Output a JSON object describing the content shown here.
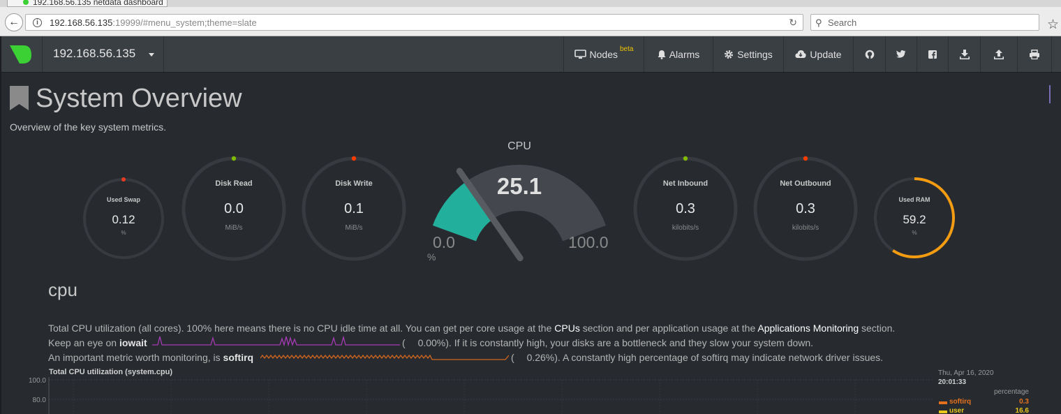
{
  "browser": {
    "tab_title": "192.168.56.135 netdata dashboard",
    "url_host": "192.168.56.135",
    "url_rest": ":19999/#menu_system;theme=slate",
    "search_placeholder": "Search"
  },
  "navbar": {
    "node_name": "192.168.56.135",
    "nodes_label": "Nodes",
    "nodes_badge": "beta",
    "alarms_label": "Alarms",
    "settings_label": "Settings",
    "update_label": "Update",
    "icons": [
      "github-icon",
      "twitter-icon",
      "facebook-icon",
      "download-icon",
      "upload-icon",
      "print-icon"
    ]
  },
  "page": {
    "title": "System Overview",
    "subtitle": "Overview of the key system metrics."
  },
  "gauges": {
    "swap": {
      "title": "Used Swap",
      "value": "0.12",
      "unit": "%",
      "fraction": 0.0012,
      "color": "#e63b22"
    },
    "disk_read": {
      "title": "Disk Read",
      "value": "0.0",
      "unit": "MiB/s",
      "fraction": 0,
      "color": "#7fba00"
    },
    "disk_write": {
      "title": "Disk Write",
      "value": "0.1",
      "unit": "MiB/s",
      "fraction": 0.005,
      "color": "#ff3c00"
    },
    "cpu": {
      "title": "CPU",
      "value": "25.1",
      "min": "0.0",
      "max": "100.0",
      "unit": "%",
      "fraction": 0.251,
      "color": "#22b09c"
    },
    "net_in": {
      "title": "Net Inbound",
      "value": "0.3",
      "unit": "kilobits/s",
      "fraction": 0,
      "color": "#7fba00"
    },
    "net_out": {
      "title": "Net Outbound",
      "value": "0.3",
      "unit": "kilobits/s",
      "fraction": 0.005,
      "color": "#ff3c00"
    },
    "ram": {
      "title": "Used RAM",
      "value": "59.2",
      "unit": "%",
      "fraction": 0.592,
      "color": "#f39c12"
    }
  },
  "cpu_section": {
    "title": "cpu",
    "line1_a": "Total CPU utilization (all cores). 100% here means there is no CPU idle time at all. You can get per core usage at the",
    "line1_link1": "CPUs",
    "line1_b": "section and per application usage at the",
    "line1_link2": "Applications Monitoring",
    "line1_c": "section.",
    "line2_a": "Keep an eye on",
    "line2_metric": "iowait",
    "line2_open": "(",
    "line2_value": "0.00%).",
    "line2_b": "If it is constantly high, your disks are a bottleneck and they slow your system down.",
    "line3_a": "An important metric worth monitoring, is",
    "line3_metric": "softirq",
    "line3_open": "(",
    "line3_value": "0.26%).",
    "line3_b": "A constantly high percentage of softirq may indicate network driver issues."
  },
  "chart": {
    "title": "Total CPU utilization (system.cpu)",
    "y_ticks": [
      "100.0",
      "80.0"
    ],
    "legend_date": "Thu, Apr 16, 2020",
    "legend_time": "20:01:33",
    "legend_units": "percentage",
    "legend": [
      {
        "name": "softirq",
        "value": "0.3",
        "color": "#e6711d"
      },
      {
        "name": "user",
        "value": "16.6",
        "color": "#e8c81d"
      }
    ]
  },
  "colors": {
    "background": "#272b30",
    "navbar": "#3a3f44",
    "iowait_spark": "#a63ab5",
    "softirq_spark": "#d4661f"
  }
}
